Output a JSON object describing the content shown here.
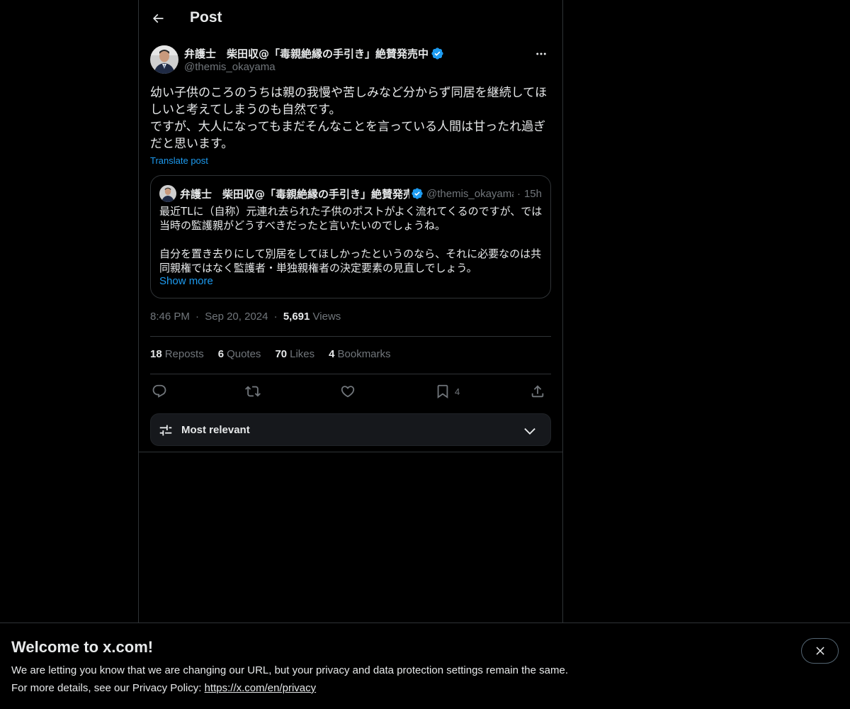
{
  "header": {
    "title": "Post"
  },
  "post": {
    "author_name": "弁護士　柴田収@「毒親絶縁の手引き」絶賛発売中",
    "author_handle": "@themis_okayama",
    "text": "幼い子供のころのうちは親の我慢や苦しみなど分からず同居を継続してほしいと考えてしまうのも自然です。\nですが、大人になってもまだそんなことを言っている人間は甘ったれ過ぎだと思います。",
    "translate_label": "Translate post",
    "time": "8:46 PM",
    "date": "Sep 20, 2024",
    "views_count": "5,691",
    "views_label": "Views",
    "dot": "·"
  },
  "quote": {
    "author_name": "弁護士　柴田収@「毒親絶縁の手引き」絶賛発売中",
    "author_handle": "@themis_okayama",
    "dot": "·",
    "time_ago": "15h",
    "text": "最近TLに（自称）元連れ去られた子供のポストがよく流れてくるのですが、では当時の監護親がどうすべきだったと言いたいのでしょうね。\n\n自分を置き去りにして別居をしてほしかったというのなら、それに必要なのは共同親権ではなく監護者・単独親権者の決定要素の見直しでしょう。",
    "show_more": "Show more"
  },
  "stats": {
    "reposts_count": "18",
    "reposts_label": "Reposts",
    "quotes_count": "6",
    "quotes_label": "Quotes",
    "likes_count": "70",
    "likes_label": "Likes",
    "bookmarks_count": "4",
    "bookmarks_label": "Bookmarks"
  },
  "actions": {
    "bookmark_count": "4"
  },
  "sort": {
    "label": "Most relevant"
  },
  "banner": {
    "title": "Welcome to x.com!",
    "line1": "We are letting you know that we are changing our URL, but your privacy and data protection settings remain the same.",
    "line2_prefix": "For more details, see our Privacy Policy: ",
    "link": "https://x.com/en/privacy"
  },
  "colors": {
    "accent": "#1d9bf0",
    "text": "#e7e9ea",
    "muted": "#71767b",
    "border": "#2f3336",
    "background": "#000000"
  }
}
